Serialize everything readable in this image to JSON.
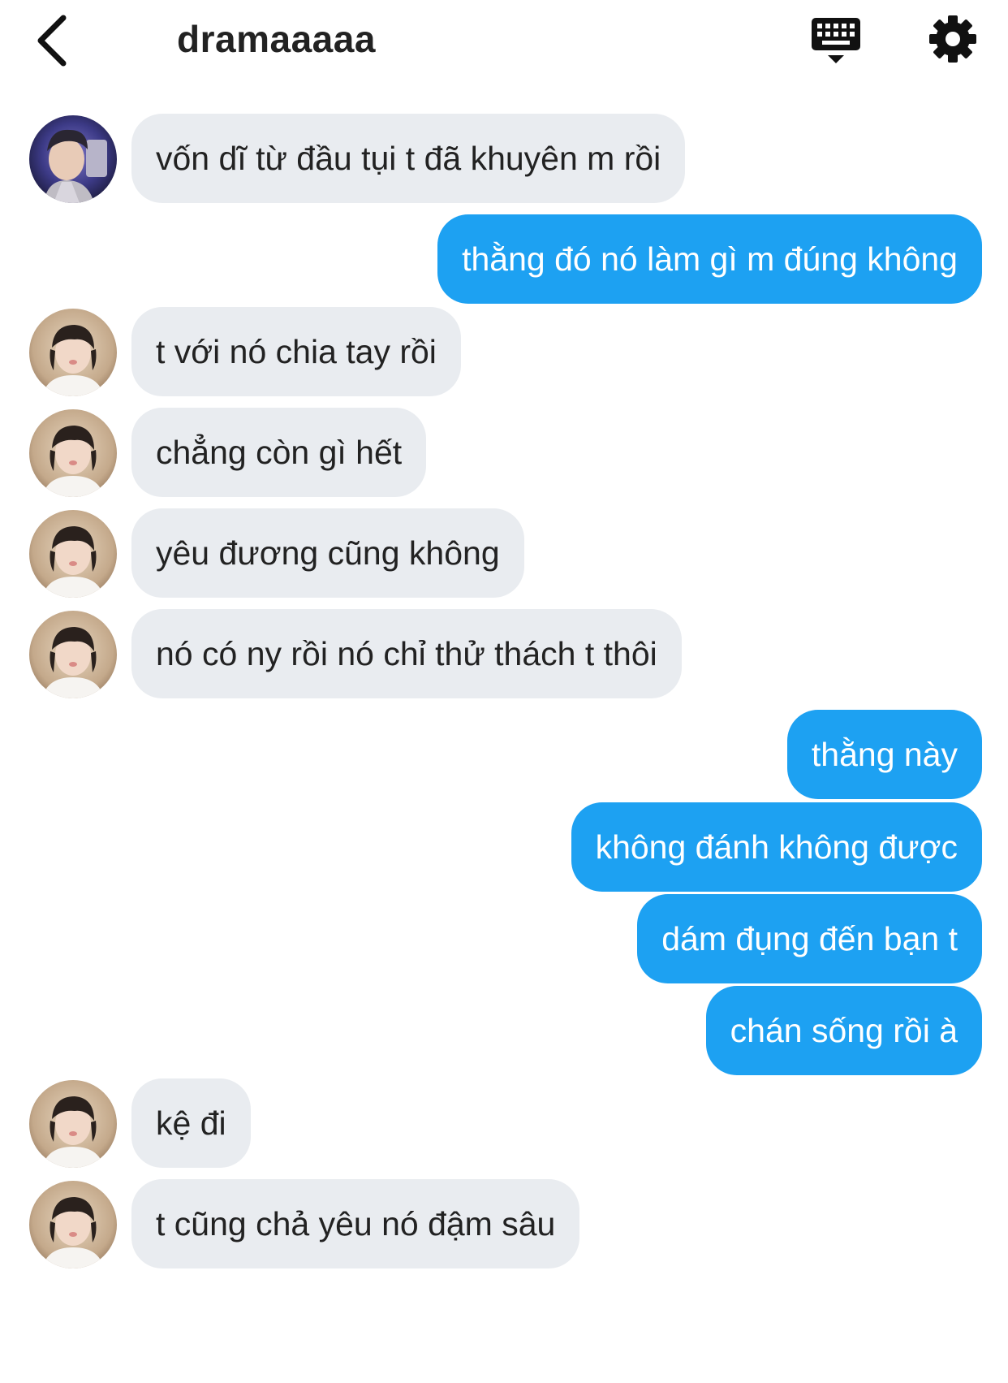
{
  "header": {
    "title": "dramaaaaa",
    "back_icon": "chevron-left-icon",
    "keyboard_icon": "keyboard-icon",
    "settings_icon": "gear-icon"
  },
  "colors": {
    "outgoing_bubble": "#1da1f2",
    "incoming_bubble": "#e9ecf0",
    "text_dark": "#222222"
  },
  "messages": [
    {
      "side": "in",
      "avatar": "avatar-1",
      "text": "vốn dĩ từ đầu tụi t đã khuyên m rồi"
    },
    {
      "side": "out",
      "text": "thằng đó nó làm gì m đúng không"
    },
    {
      "side": "in",
      "avatar": "avatar-2",
      "text": "t với nó chia tay rồi"
    },
    {
      "side": "in",
      "avatar": "avatar-2",
      "text": "chẳng còn gì hết"
    },
    {
      "side": "in",
      "avatar": "avatar-2",
      "text": "yêu đương cũng không"
    },
    {
      "side": "in",
      "avatar": "avatar-2",
      "text": "nó có ny rồi nó chỉ thử thách t thôi"
    },
    {
      "side": "out",
      "text": "thằng này"
    },
    {
      "side": "out",
      "text": "không đánh không được"
    },
    {
      "side": "out",
      "text": "dám đụng đến bạn t"
    },
    {
      "side": "out",
      "text": "chán sống rồi à"
    },
    {
      "side": "in",
      "avatar": "avatar-2",
      "text": "kệ đi"
    },
    {
      "side": "in",
      "avatar": "avatar-2",
      "text": "t cũng chả yêu nó đậm sâu"
    }
  ]
}
